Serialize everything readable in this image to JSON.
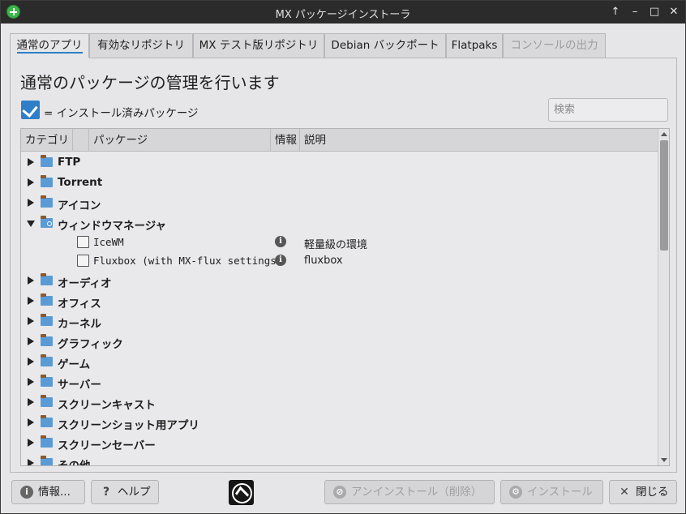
{
  "window": {
    "title": "MX パッケージインストーラ",
    "controls": [
      "↑",
      "–",
      "□",
      "✕"
    ]
  },
  "tabs": [
    {
      "label": "通常のアプリ",
      "active": true,
      "enabled": true
    },
    {
      "label": "有効なリポジトリ",
      "active": false,
      "enabled": true
    },
    {
      "label": "MX テスト版リポジトリ",
      "active": false,
      "enabled": true
    },
    {
      "label": "Debian バックポート",
      "active": false,
      "enabled": true
    },
    {
      "label": "Flatpaks",
      "active": false,
      "enabled": true
    },
    {
      "label": "コンソールの出力",
      "active": false,
      "enabled": false
    }
  ],
  "main": {
    "heading": "通常のパッケージの管理を行います",
    "legend_text": "= インストール済みパッケージ",
    "search_placeholder": "検索"
  },
  "tree": {
    "columns": [
      "カテゴリ",
      "パッケージ",
      "情報",
      "説明"
    ],
    "rows": [
      {
        "type": "category",
        "label": "FTP",
        "expanded": false
      },
      {
        "type": "category",
        "label": "Torrent",
        "expanded": false
      },
      {
        "type": "category",
        "label": "アイコン",
        "expanded": false
      },
      {
        "type": "category",
        "label": "ウィンドウマネージャ",
        "expanded": true
      },
      {
        "type": "package",
        "name": "IceWM",
        "description": "軽量級の環境",
        "checked": false
      },
      {
        "type": "package",
        "name": "Fluxbox (with MX-flux settings)",
        "description": "fluxbox",
        "checked": false
      },
      {
        "type": "category",
        "label": "オーディオ",
        "expanded": false
      },
      {
        "type": "category",
        "label": "オフィス",
        "expanded": false
      },
      {
        "type": "category",
        "label": "カーネル",
        "expanded": false
      },
      {
        "type": "category",
        "label": "グラフィック",
        "expanded": false
      },
      {
        "type": "category",
        "label": "ゲーム",
        "expanded": false
      },
      {
        "type": "category",
        "label": "サーバー",
        "expanded": false
      },
      {
        "type": "category",
        "label": "スクリーンキャスト",
        "expanded": false
      },
      {
        "type": "category",
        "label": "スクリーンショット用アプリ",
        "expanded": false
      },
      {
        "type": "category",
        "label": "スクリーンセーバー",
        "expanded": false
      },
      {
        "type": "category",
        "label": "その他",
        "expanded": false
      }
    ]
  },
  "footer": {
    "info_button": "情報...",
    "help_button": "ヘルプ",
    "uninstall_button": "アンインストール（削除）",
    "install_button": "インストール",
    "close_button": "閉じる"
  },
  "colors": {
    "accent": "#2f7ec8",
    "titlebar": "#2b2b2b",
    "folder": "#5b9bd5"
  }
}
